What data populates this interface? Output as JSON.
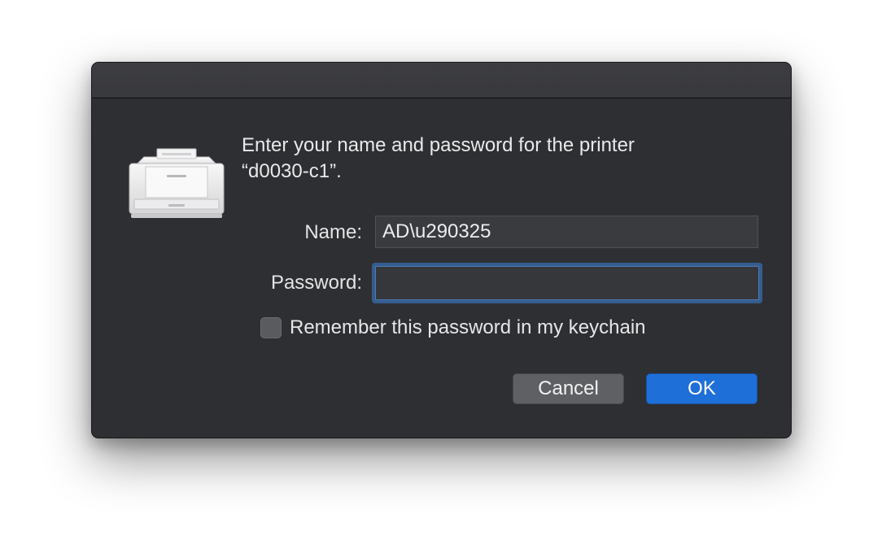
{
  "dialog": {
    "message_line1": "Enter your name and password for the printer",
    "message_line2": "“d0030-c1”.",
    "icon": "printer-icon"
  },
  "name_field": {
    "label": "Name:",
    "value": "AD\\u290325"
  },
  "password_field": {
    "label": "Password:",
    "value": ""
  },
  "remember": {
    "label": "Remember this password in my keychain",
    "checked": false
  },
  "buttons": {
    "cancel": "Cancel",
    "ok": "OK"
  },
  "colors": {
    "dialog_bg": "#2e2f33",
    "accent": "#1f6fd8",
    "focus_ring": "#345d8e"
  }
}
